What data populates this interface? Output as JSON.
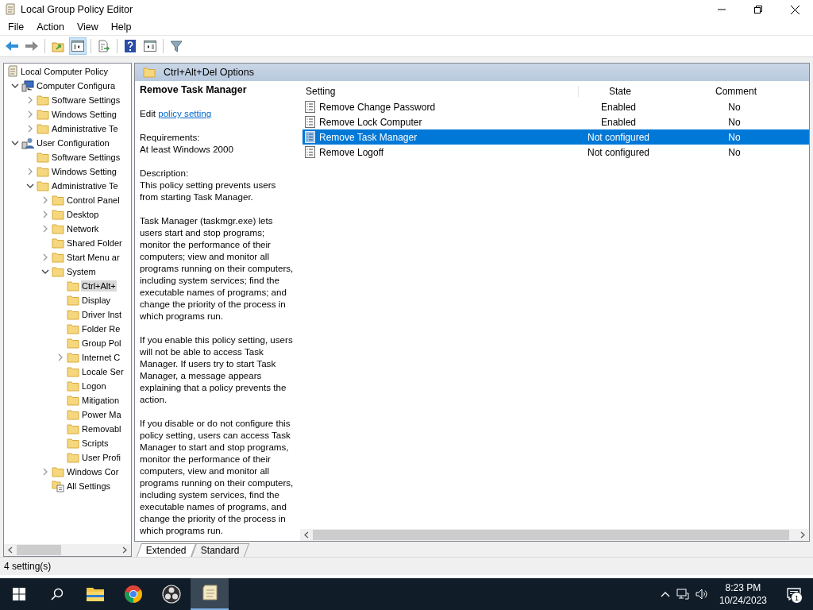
{
  "window": {
    "title": "Local Group Policy Editor"
  },
  "menu": [
    "File",
    "Action",
    "View",
    "Help"
  ],
  "toolbar": [
    {
      "kind": "back"
    },
    {
      "kind": "forward"
    },
    {
      "kind": "sep"
    },
    {
      "kind": "up"
    },
    {
      "kind": "tree",
      "selected": true
    },
    {
      "kind": "sep"
    },
    {
      "kind": "export"
    },
    {
      "kind": "sep"
    },
    {
      "kind": "help"
    },
    {
      "kind": "pane",
      "selected": false
    },
    {
      "kind": "sep"
    },
    {
      "kind": "filter"
    }
  ],
  "tree": {
    "label": "Local Computer Policy",
    "kind": "policy",
    "selected": false,
    "children": [
      {
        "label": "Computer Configura",
        "kind": "computer",
        "expanded": true,
        "selected": false,
        "children": [
          {
            "label": "Software Settings",
            "kind": "folder",
            "expanded": false,
            "selected": false
          },
          {
            "label": "Windows Setting",
            "kind": "folder",
            "expanded": false,
            "selected": false
          },
          {
            "label": "Administrative Te",
            "kind": "folder",
            "expanded": false,
            "selected": false
          }
        ]
      },
      {
        "label": "User Configuration",
        "kind": "user",
        "expanded": true,
        "selected": false,
        "children": [
          {
            "label": "Software Settings",
            "kind": "folder",
            "selected": false
          },
          {
            "label": "Windows Setting",
            "kind": "folder",
            "expanded": false,
            "selected": false
          },
          {
            "label": "Administrative Te",
            "kind": "folder",
            "expanded": true,
            "selected": false,
            "children": [
              {
                "label": "Control Panel",
                "kind": "folder",
                "expanded": false,
                "selected": false
              },
              {
                "label": "Desktop",
                "kind": "folder",
                "expanded": false,
                "selected": false
              },
              {
                "label": "Network",
                "kind": "folder",
                "expanded": false,
                "selected": false
              },
              {
                "label": "Shared Folder",
                "kind": "folder",
                "selected": false
              },
              {
                "label": "Start Menu ar",
                "kind": "folder",
                "expanded": false,
                "selected": false
              },
              {
                "label": "System",
                "kind": "folder",
                "expanded": true,
                "selected": false,
                "children": [
                  {
                    "label": "Ctrl+Alt+",
                    "kind": "folder",
                    "selected": true
                  },
                  {
                    "label": "Display",
                    "kind": "folder",
                    "selected": false
                  },
                  {
                    "label": "Driver Inst",
                    "kind": "folder",
                    "selected": false
                  },
                  {
                    "label": "Folder Re",
                    "kind": "folder",
                    "selected": false
                  },
                  {
                    "label": "Group Pol",
                    "kind": "folder",
                    "selected": false
                  },
                  {
                    "label": "Internet C",
                    "kind": "folder",
                    "expanded": false,
                    "selected": false
                  },
                  {
                    "label": "Locale Ser",
                    "kind": "folder",
                    "selected": false
                  },
                  {
                    "label": "Logon",
                    "kind": "folder",
                    "selected": false
                  },
                  {
                    "label": "Mitigation",
                    "kind": "folder",
                    "selected": false
                  },
                  {
                    "label": "Power Ma",
                    "kind": "folder",
                    "selected": false
                  },
                  {
                    "label": "Removabl",
                    "kind": "folder",
                    "selected": false
                  },
                  {
                    "label": "Scripts",
                    "kind": "folder",
                    "selected": false
                  },
                  {
                    "label": "User Profi",
                    "kind": "folder",
                    "selected": false
                  }
                ]
              },
              {
                "label": "Windows Cor",
                "kind": "folder",
                "expanded": false,
                "selected": false
              },
              {
                "label": "All Settings",
                "kind": "all-settings",
                "selected": false
              }
            ]
          }
        ]
      }
    ]
  },
  "header": {
    "title": "Ctrl+Alt+Del Options"
  },
  "details": {
    "title": "Remove Task Manager",
    "edit_prefix": "Edit",
    "edit_link": "policy setting",
    "requirements_label": "Requirements:",
    "requirements": "At least Windows 2000",
    "description_label": "Description:",
    "paragraphs": [
      "This policy setting prevents users from starting Task Manager.",
      "Task Manager (taskmgr.exe) lets users start and stop programs; monitor the performance of their computers; view and monitor all programs running on their computers, including system services; find the executable names of programs; and change the priority of the process in which programs run.",
      "If you enable this policy setting, users will not be able to access Task Manager. If users try to start Task Manager, a message appears explaining that a policy prevents the action.",
      "If you disable or do not configure this policy setting, users can access Task Manager to  start and stop programs, monitor the performance of their computers, view and monitor all programs running on their computers, including system services, find the executable names of programs, and change the priority of the process in which programs run."
    ]
  },
  "table": {
    "columns": [
      "Setting",
      "State",
      "Comment"
    ],
    "rows": [
      {
        "setting": "Remove Change Password",
        "state": "Enabled",
        "comment": "No",
        "selected": false
      },
      {
        "setting": "Remove Lock Computer",
        "state": "Enabled",
        "comment": "No",
        "selected": false
      },
      {
        "setting": "Remove Task Manager",
        "state": "Not configured",
        "comment": "No",
        "selected": true
      },
      {
        "setting": "Remove Logoff",
        "state": "Not configured",
        "comment": "No",
        "selected": false
      }
    ]
  },
  "tabs": [
    {
      "label": "Extended",
      "selected": true
    },
    {
      "label": "Standard",
      "selected": false
    }
  ],
  "status_bar": "4 setting(s)",
  "taskbar": {
    "apps": [
      {
        "kind": "explorer",
        "active": false
      },
      {
        "kind": "chrome",
        "active": false
      },
      {
        "kind": "obs",
        "active": false
      },
      {
        "kind": "policy",
        "active": true
      }
    ],
    "time": "8:23 PM",
    "date": "10/24/2023",
    "notifications": "1"
  }
}
